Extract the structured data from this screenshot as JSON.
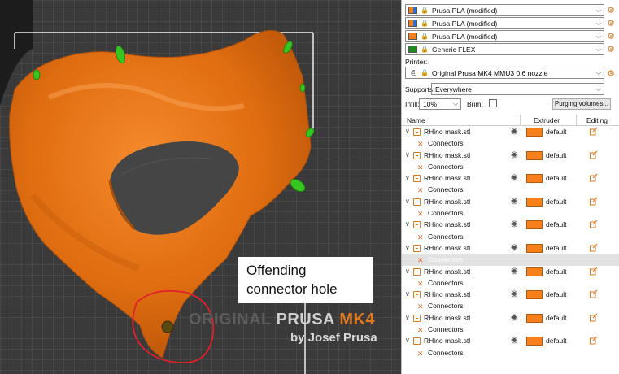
{
  "viewport": {
    "bed_logo": {
      "part1": "ORIGINAL",
      "part2": " PRUSA ",
      "part3": "MK4",
      "sub": "by Josef Prusa"
    },
    "callout": {
      "line1": "Offending",
      "line2": "connector hole"
    }
  },
  "filaments": [
    {
      "label": "Prusa PLA (modified)",
      "colors": [
        "#f7801a",
        "#2b6fd6"
      ]
    },
    {
      "label": "Prusa PLA (modified)",
      "colors": [
        "#f7801a",
        "#2b6fd6"
      ]
    },
    {
      "label": "Prusa PLA (modified)",
      "colors": [
        "#f7801a",
        "#f7801a"
      ]
    },
    {
      "label": "Generic FLEX",
      "colors": [
        "#1f8a1f",
        "#1f8a1f"
      ]
    }
  ],
  "printer": {
    "label": "Printer:",
    "value": "Original Prusa MK4 MMU3 0.6 nozzle"
  },
  "supports": {
    "label": "Supports:",
    "value": "Everywhere"
  },
  "infill": {
    "label": "Infill:",
    "value": "10%"
  },
  "brim": {
    "label": "Brim:",
    "checked": false
  },
  "purge_button": "Purging volumes...",
  "table": {
    "col_name": "Name",
    "col_extruder": "Extruder",
    "col_editing": "Editing",
    "objects": [
      {
        "name": "RHino mask.stl",
        "extruder": "default",
        "child": "Connectors",
        "selected": false
      },
      {
        "name": "RHino mask.stl",
        "extruder": "default",
        "child": "Connectors",
        "selected": false
      },
      {
        "name": "RHino mask.stl",
        "extruder": "default",
        "child": "Connectors",
        "selected": false
      },
      {
        "name": "RHino mask.stl",
        "extruder": "default",
        "child": "Connectors",
        "selected": false
      },
      {
        "name": "RHino mask.stl",
        "extruder": "default",
        "child": "Connectors",
        "selected": false
      },
      {
        "name": "RHino mask.stl",
        "extruder": "default",
        "child": "Connectors",
        "selected": true
      },
      {
        "name": "RHino mask.stl",
        "extruder": "default",
        "child": "Connectors",
        "selected": false
      },
      {
        "name": "RHino mask.stl",
        "extruder": "default",
        "child": "Connectors",
        "selected": false
      },
      {
        "name": "RHino mask.stl",
        "extruder": "default",
        "child": "Connectors",
        "selected": false
      },
      {
        "name": "RHino mask.stl",
        "extruder": "default",
        "child": "Connectors",
        "selected": false
      }
    ]
  },
  "colors": {
    "accent": "#e0791e",
    "extruder": "#f7801a",
    "selection": "#e2e2e2"
  }
}
